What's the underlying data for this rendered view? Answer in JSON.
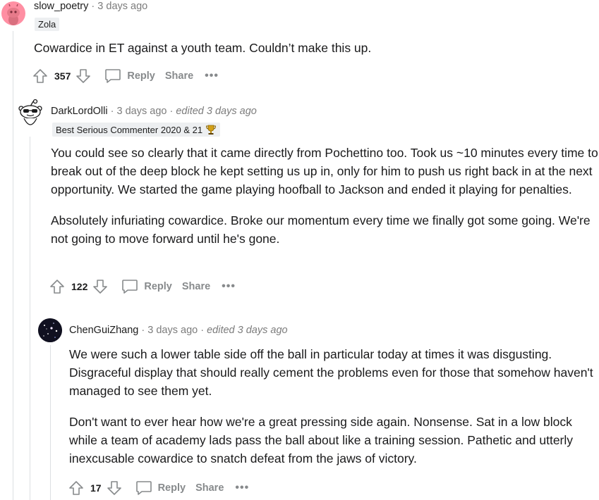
{
  "comments": [
    {
      "username": "slow_poetry",
      "sep": "·",
      "time": "3 days ago",
      "flair": "Zola",
      "paragraphs": [
        "Cowardice in ET against a youth team. Couldn’t make this up."
      ],
      "score": "357",
      "reply_label": "Reply",
      "share_label": "Share",
      "more_label": "•••"
    },
    {
      "username": "DarkLordOlli",
      "sep": "·",
      "time": "3 days ago",
      "sep2": "·",
      "edited": "edited 3 days ago",
      "flair": "Best Serious Commenter 2020 & 21",
      "paragraphs": [
        "You could see so clearly that it came directly from Pochettino too. Took us ~10 minutes every time to break out of the deep block he kept setting us up in, only for him to push us right back in at the next opportunity. We started the game playing hoofball to Jackson and ended it playing for penalties.",
        "Absolutely infuriating cowardice. Broke our momentum every time we finally got some going. We're not going to move forward until he's gone."
      ],
      "score": "122",
      "reply_label": "Reply",
      "share_label": "Share",
      "more_label": "•••"
    },
    {
      "username": "ChenGuiZhang",
      "sep": "·",
      "time": "3 days ago",
      "sep2": "·",
      "edited": "edited 3 days ago",
      "paragraphs": [
        "We were such a lower table side off the ball in particular today at times it was disgusting. Disgraceful display that should really cement the problems even for those that somehow haven't managed to see them yet.",
        "Don't want to ever hear how we're a great pressing side again. Nonsense. Sat in a low block while a team of academy lads pass the ball about like a training session. Pathetic and utterly inexcusable cowardice to snatch defeat from the jaws of victory."
      ],
      "score": "17",
      "reply_label": "Reply",
      "share_label": "Share",
      "more_label": "•••"
    }
  ],
  "colors": {
    "meta": "#7c7c7c",
    "action": "#878a8c",
    "thread_line": "#dcdfe2",
    "flair_bg": "#edeff1",
    "avatar1_bg": "#ff8fa3"
  }
}
